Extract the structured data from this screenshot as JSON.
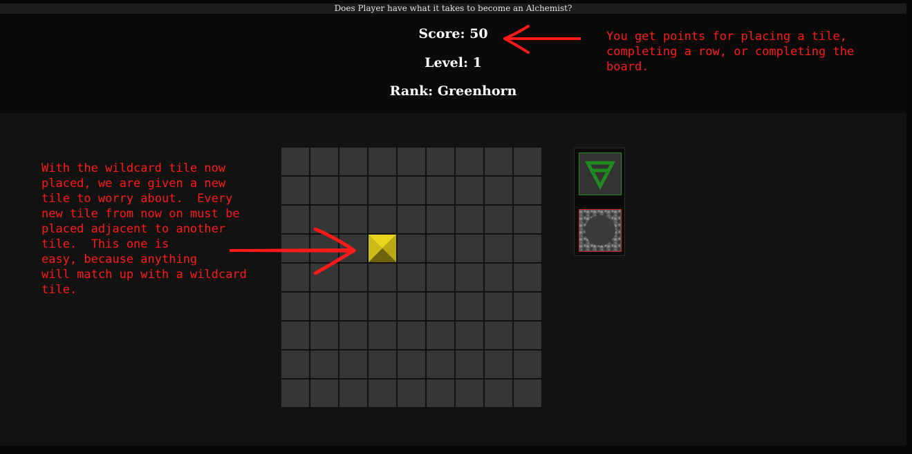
{
  "page": {
    "title": "Does Player have what it takes to become an Alchemist?"
  },
  "stats": {
    "score": "Score: 50",
    "level": "Level: 1",
    "rank": "Rank: Greenhorn"
  },
  "board": {
    "rows": 9,
    "cols": 9,
    "placed_tiles": [
      {
        "row": 3,
        "col": 3,
        "kind": "wildcard",
        "color": "#d4c21a"
      }
    ]
  },
  "tray": {
    "current_tile": {
      "symbol": "earth-triangle-icon",
      "color": "#1f8a1f"
    },
    "next_tile": {
      "symbol": "stone-disc-icon",
      "border_color": "#cc2222"
    }
  },
  "annotations": {
    "score_note": "You get points for placing a tile,\ncompleting a row, or completing the\nboard.",
    "tile_note": "With the wildcard tile now\nplaced, we are given a new\ntile to worry about.  Every\nnew tile from now on must be\nplaced adjacent to another\ntile.  This one is\neasy, because anything\nwill match up with a wildcard\ntile.",
    "color": "#ff1a1a"
  }
}
